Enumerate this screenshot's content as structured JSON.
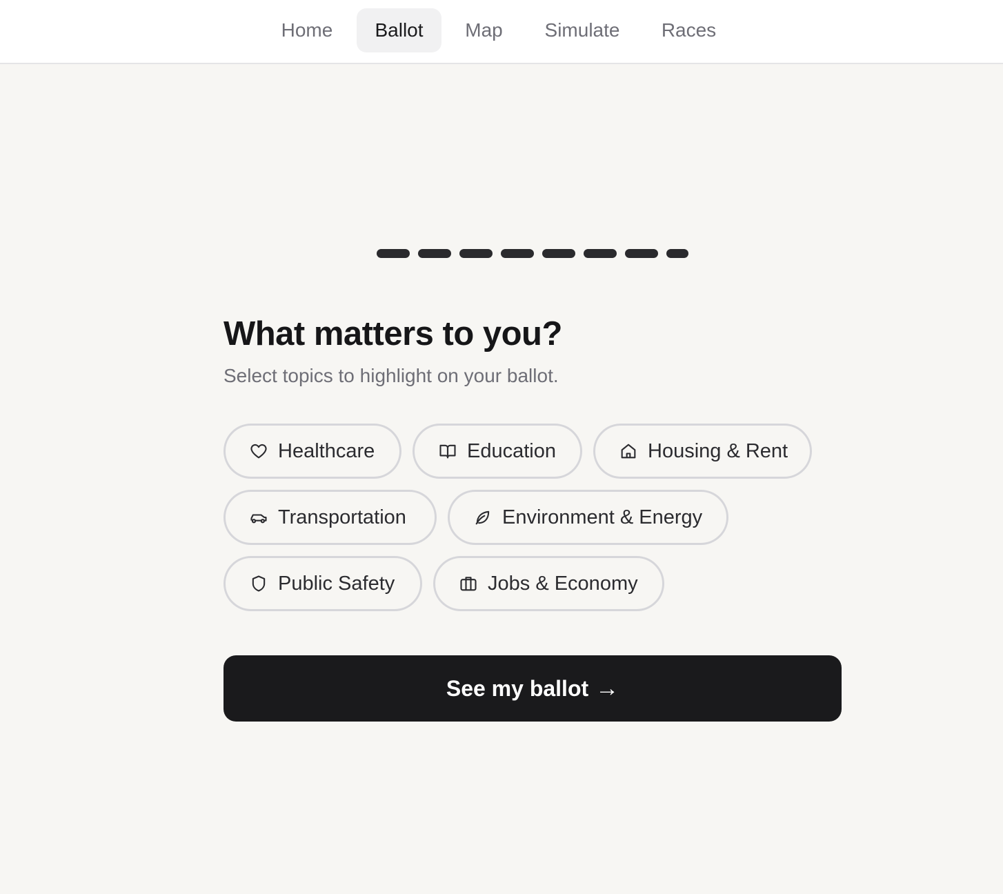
{
  "nav": {
    "tabs": [
      {
        "label": "Home",
        "active": false
      },
      {
        "label": "Ballot",
        "active": true
      },
      {
        "label": "Map",
        "active": false
      },
      {
        "label": "Simulate",
        "active": false
      },
      {
        "label": "Races",
        "active": false
      }
    ]
  },
  "progress": {
    "steps_total": 8,
    "steps_complete": 8
  },
  "main": {
    "title": "What matters to you?",
    "subtitle": "Select topics to highlight on your ballot.",
    "topics": [
      {
        "label": "Healthcare",
        "icon": "heart-icon"
      },
      {
        "label": "Education",
        "icon": "book-icon"
      },
      {
        "label": "Housing & Rent",
        "icon": "house-icon"
      },
      {
        "label": "Transportation",
        "icon": "car-icon"
      },
      {
        "label": "Environment & Energy",
        "icon": "leaf-icon"
      },
      {
        "label": "Public Safety",
        "icon": "shield-icon"
      },
      {
        "label": "Jobs & Economy",
        "icon": "briefcase-icon"
      }
    ],
    "cta_label": "See my ballot",
    "cta_arrow": "→"
  },
  "colors": {
    "background": "#f7f6f3",
    "nav_background": "#ffffff",
    "cta_background": "#1a1a1c",
    "pill_border": "#d6d6da",
    "muted_text": "#6e6e76"
  }
}
